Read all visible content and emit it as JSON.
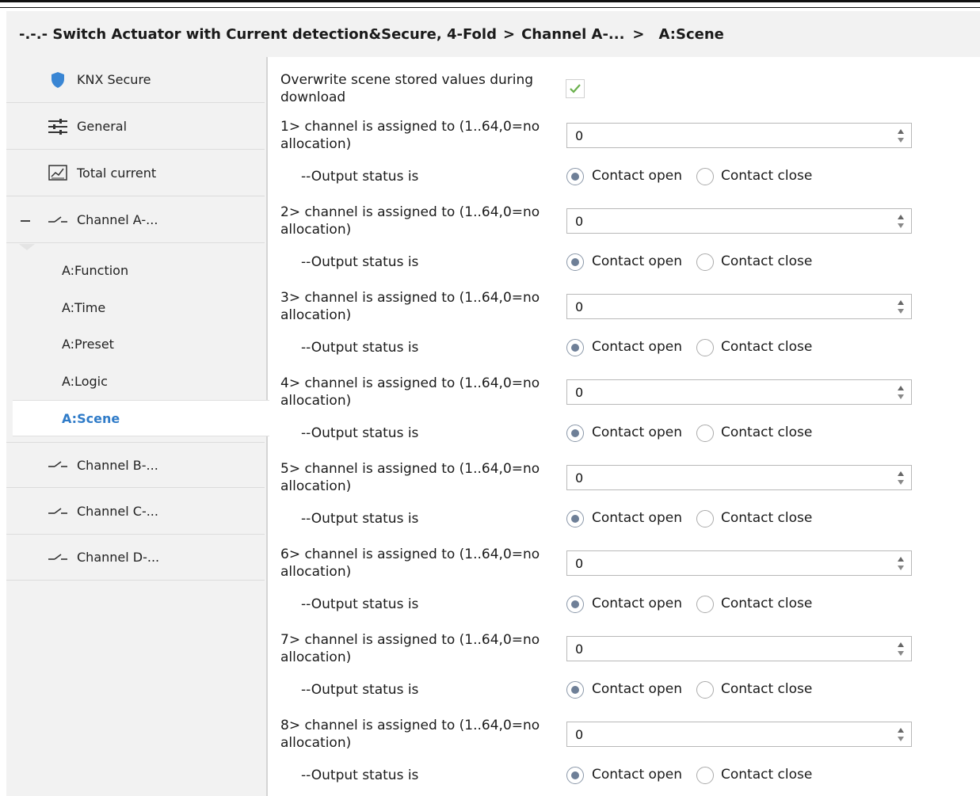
{
  "header": {
    "crumbs": [
      "-.-.- Switch Actuator with Current detection&Secure, 4-Fold",
      "Channel A-...",
      "A:Scene"
    ],
    "separator": ">"
  },
  "sidebar": {
    "items": [
      {
        "label": "KNX Secure",
        "icon": "shield-icon"
      },
      {
        "label": "General",
        "icon": "sliders-icon"
      },
      {
        "label": "Total current",
        "icon": "chart-icon"
      },
      {
        "label": "Channel A-...",
        "icon": "switch-contact-icon",
        "expanded": true
      },
      {
        "label": "Channel B-...",
        "icon": "switch-contact-icon"
      },
      {
        "label": "Channel C-...",
        "icon": "switch-contact-icon"
      },
      {
        "label": "Channel D-...",
        "icon": "switch-contact-icon"
      }
    ],
    "sub_items": [
      "A:Function",
      "A:Time",
      "A:Preset",
      "A:Logic",
      "A:Scene"
    ],
    "selected_sub": "A:Scene"
  },
  "main": {
    "overwrite": {
      "label": "Overwrite scene stored values during download",
      "checked": true
    },
    "rows": [
      {
        "label": "1> channel is assigned to (1..64,0=no allocation)",
        "value": "0",
        "status_label": "--Output status is",
        "options": [
          "Contact open",
          "Contact close"
        ],
        "selected": "Contact open"
      },
      {
        "label": "2> channel is assigned to (1..64,0=no allocation)",
        "value": "0",
        "status_label": "--Output status is",
        "options": [
          "Contact open",
          "Contact close"
        ],
        "selected": "Contact open"
      },
      {
        "label": "3> channel is assigned to (1..64,0=no allocation)",
        "value": "0",
        "status_label": "--Output status is",
        "options": [
          "Contact open",
          "Contact close"
        ],
        "selected": "Contact open"
      },
      {
        "label": "4> channel is assigned to (1..64,0=no allocation)",
        "value": "0",
        "status_label": "--Output status is",
        "options": [
          "Contact open",
          "Contact close"
        ],
        "selected": "Contact open"
      },
      {
        "label": "5> channel is assigned to (1..64,0=no allocation)",
        "value": "0",
        "status_label": "--Output status is",
        "options": [
          "Contact open",
          "Contact close"
        ],
        "selected": "Contact open"
      },
      {
        "label": "6> channel is assigned to (1..64,0=no allocation)",
        "value": "0",
        "status_label": "--Output status is",
        "options": [
          "Contact open",
          "Contact close"
        ],
        "selected": "Contact open"
      },
      {
        "label": "7> channel is assigned to (1..64,0=no allocation)",
        "value": "0",
        "status_label": "--Output status is",
        "options": [
          "Contact open",
          "Contact close"
        ],
        "selected": "Contact open"
      },
      {
        "label": "8> channel is assigned to (1..64,0=no allocation)",
        "value": "0",
        "status_label": "--Output status is",
        "options": [
          "Contact open",
          "Contact close"
        ],
        "selected": "Contact open"
      }
    ]
  },
  "colors": {
    "accent": "#2f7bc8",
    "shield": "#3a86d4",
    "radio_dot": "#6e7f97",
    "check": "#6ab04c",
    "panel_bg": "#f2f2f2"
  }
}
